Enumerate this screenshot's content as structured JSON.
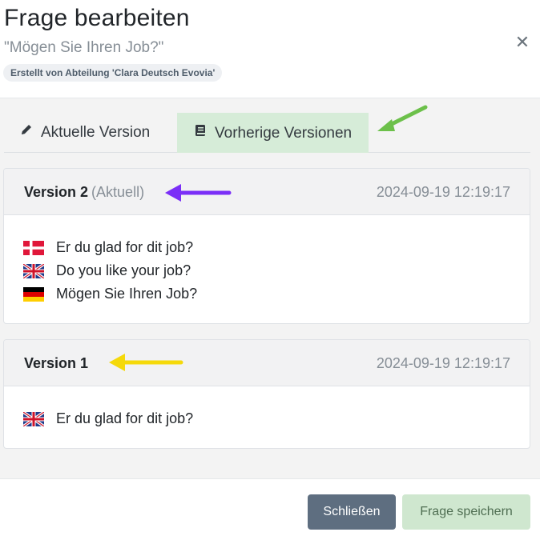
{
  "header": {
    "title": "Frage bearbeiten",
    "subtitle": "\"Mögen Sie Ihren Job?\"",
    "badge": "Erstellt von Abteilung 'Clara Deutsch Evovia'",
    "close_glyph": "✕"
  },
  "tabs": [
    {
      "label": "Aktuelle Version",
      "icon": "pencil-icon",
      "active": false
    },
    {
      "label": "Vorherige Versionen",
      "icon": "book-icon",
      "active": true
    }
  ],
  "versions": [
    {
      "name": "Version 2",
      "tag": "(Aktuell)",
      "date": "2024-09-19 12:19:17",
      "translations": [
        {
          "flag": "flag-denmark-icon",
          "text": "Er du glad for dit job?"
        },
        {
          "flag": "flag-uk-icon",
          "text": "Do you like your job?"
        },
        {
          "flag": "flag-germany-icon",
          "text": "Mögen Sie Ihren Job?"
        }
      ]
    },
    {
      "name": "Version 1",
      "tag": "",
      "date": "2024-09-19 12:19:17",
      "translations": [
        {
          "flag": "flag-uk-icon",
          "text": "Er du glad for dit job?"
        }
      ]
    }
  ],
  "footer": {
    "close_label": "Schließen",
    "save_label": "Frage speichern"
  },
  "annotation_colors": {
    "green_arrow": "#6cc04a",
    "purple_arrow": "#7b2ff7",
    "yellow_arrow": "#f5d90a"
  }
}
